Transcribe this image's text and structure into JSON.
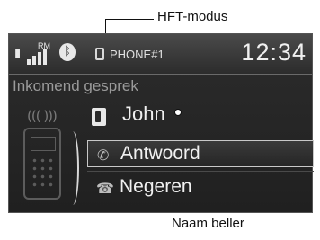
{
  "callouts": {
    "hft_mode": "HFT-modus",
    "caller_name": "Naam beller"
  },
  "status": {
    "roaming": "RM",
    "phone_label": "PHONE#1",
    "time": "12:34"
  },
  "mode_text": "Inkomend gesprek",
  "caller": {
    "name": "John"
  },
  "options": [
    {
      "label": "Antwoord",
      "icon": "phone-answer-icon",
      "selected": true
    },
    {
      "label": "Negeren",
      "icon": "phone-hangup-icon",
      "selected": false
    }
  ],
  "colors": {
    "screen_bg": "#242424",
    "text": "#f0f0f0",
    "dim_text": "#9a9a9a",
    "highlight_border": "#c8c8c8"
  }
}
